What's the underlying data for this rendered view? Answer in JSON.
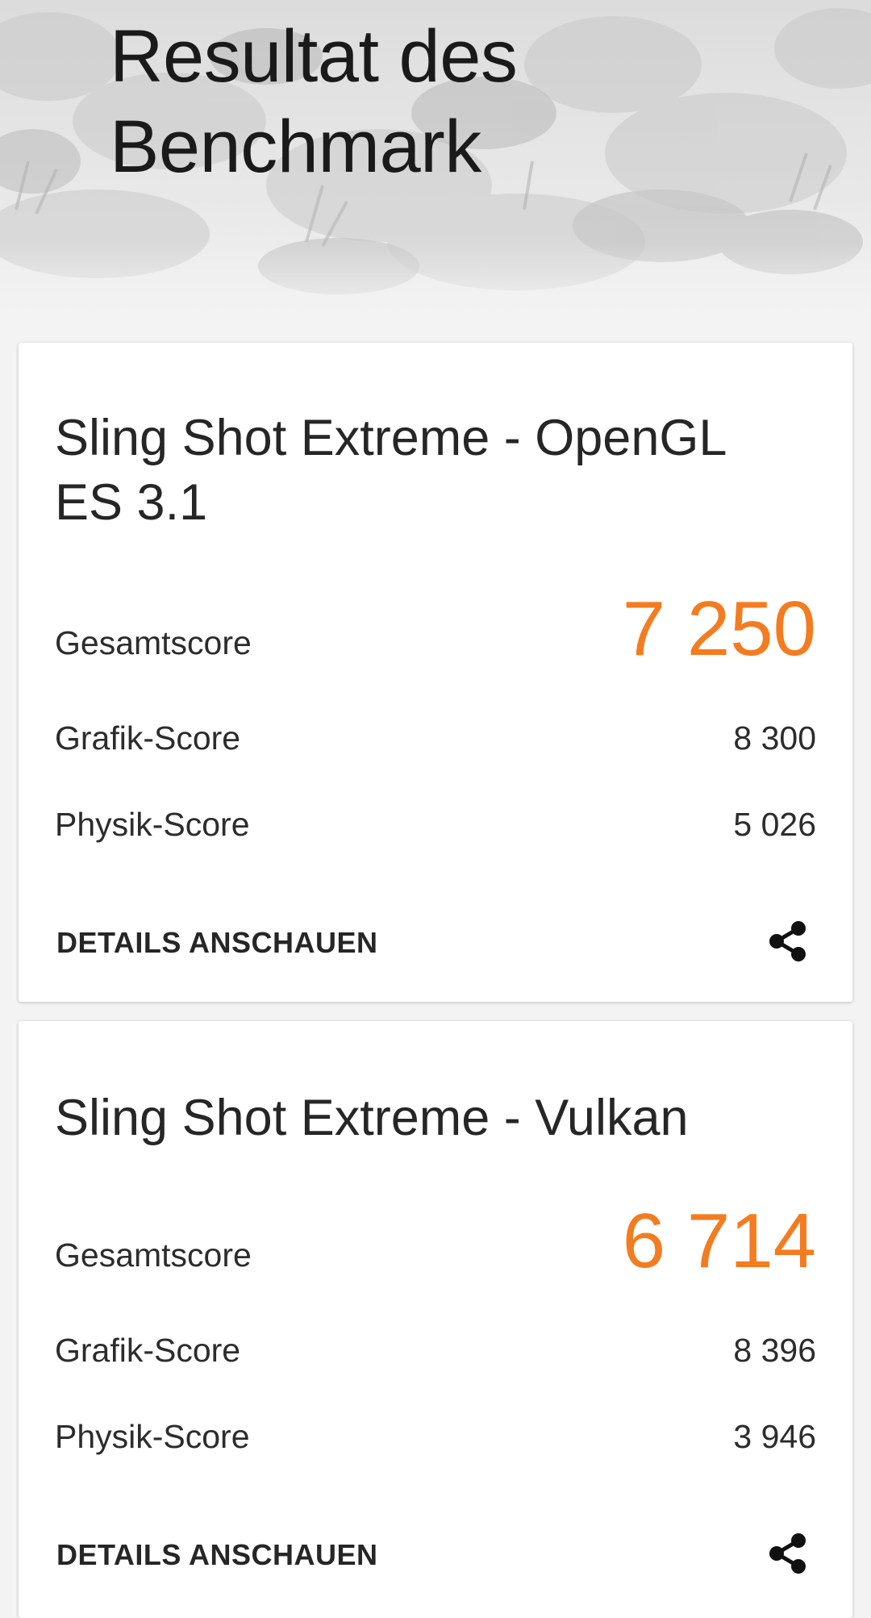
{
  "header": {
    "title_line1": "Resultat des",
    "title_line2": "Benchmark"
  },
  "colors": {
    "accent": "#f47c20",
    "card_background": "#ffffff",
    "page_background": "#f3f3f3"
  },
  "results": [
    {
      "title_line1": "Sling Shot Extreme - OpenGL",
      "title_line2": "ES 3.1",
      "overall_label": "Gesamtscore",
      "overall_value": "7 250",
      "graphics_label": "Grafik-Score",
      "graphics_value": "8 300",
      "physics_label": "Physik-Score",
      "physics_value": "5 026",
      "details_label": "DETAILS ANSCHAUEN",
      "share_icon": "share-icon"
    },
    {
      "title_line1": "Sling Shot Extreme - Vulkan",
      "overall_label": "Gesamtscore",
      "overall_value": "6 714",
      "graphics_label": "Grafik-Score",
      "graphics_value": "8 396",
      "physics_label": "Physik-Score",
      "physics_value": "3 946",
      "details_label": "DETAILS ANSCHAUEN",
      "share_icon": "share-icon"
    }
  ]
}
